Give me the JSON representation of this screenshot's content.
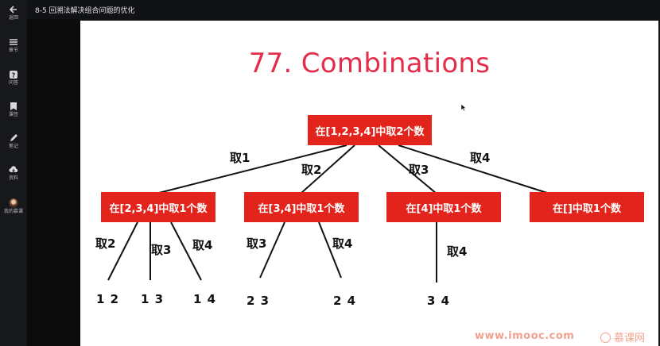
{
  "sidebar": {
    "items": [
      {
        "icon": "back-arrow-icon",
        "label": "返回"
      },
      {
        "icon": "menu-icon",
        "label": "章节"
      },
      {
        "icon": "question-icon",
        "label": "问答"
      },
      {
        "icon": "book-icon",
        "label": "课签"
      },
      {
        "icon": "pencil-icon",
        "label": "笔记"
      },
      {
        "icon": "cloud-download-icon",
        "label": "资料"
      },
      {
        "icon": "avatar",
        "label": "我的慕课"
      }
    ]
  },
  "header": {
    "title": "8-5 回溯法解决组合问题的优化"
  },
  "slide": {
    "title": "77. Combinations",
    "root": "在[1,2,3,4]中取2个数",
    "level1": [
      {
        "label": "在[2,3,4]中取1个数",
        "edge": "取1"
      },
      {
        "label": "在[3,4]中取1个数",
        "edge": "取2"
      },
      {
        "label": "在[4]中取1个数",
        "edge": "取3"
      },
      {
        "label": "在[]中取1个数",
        "edge": "取4"
      }
    ],
    "level2_edges": [
      "取2",
      "取3",
      "取4",
      "取3",
      "取4",
      "取4"
    ],
    "leaves": [
      "1 2",
      "1 3",
      "1 4",
      "2 3",
      "2 4",
      "3 4"
    ],
    "watermark": "www.imooc.com",
    "brand": "慕课网"
  },
  "colors": {
    "title": "#e42d4a",
    "node": "#e3241c",
    "sidebar": "#17181b",
    "watermark": "#f3a28f"
  }
}
